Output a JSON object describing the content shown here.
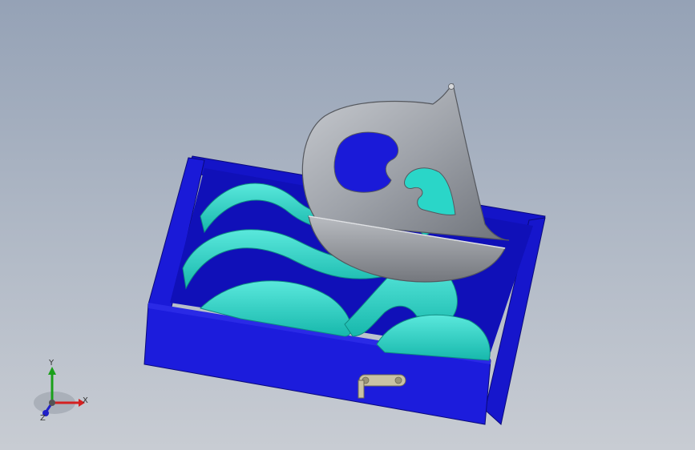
{
  "viewport": {
    "background_top": "#95a2b6",
    "background_bottom": "#c8ccd3"
  },
  "model": {
    "box_color": "#1a1ad6",
    "box_shadow_color": "#0a0a9a",
    "wave_color": "#2ad6c8",
    "sail_color": "#9a9ea6"
  },
  "triad": {
    "x_label": "X",
    "y_label": "Y",
    "z_label": "Z",
    "x_color": "#d42020",
    "y_color": "#1aa01a",
    "z_color": "#2020c8"
  }
}
